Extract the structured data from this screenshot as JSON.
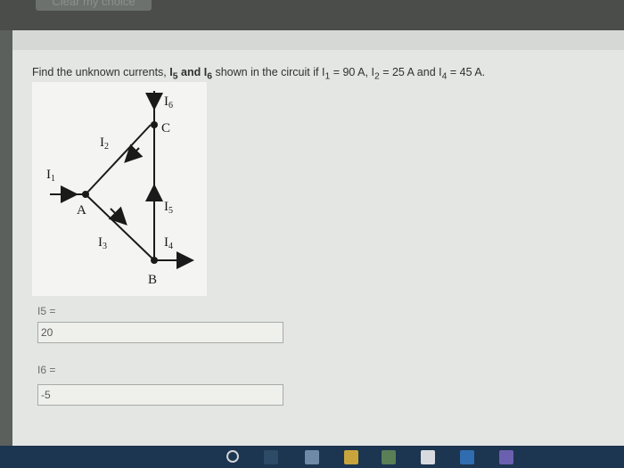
{
  "top_bar": {
    "clear_choice_label": "Clear my choice"
  },
  "question": {
    "prefix": "Find the unknown currents, ",
    "i5": "I",
    "i5_sub": "5",
    "and": " and ",
    "i6": "I",
    "i6_sub": "6",
    "suffix": " shown in the circuit if I",
    "i1_sub": "1",
    "i1_val": " = 90 A, I",
    "i2_sub": "2",
    "i2_val": " = 25 A and I",
    "i4_sub": "4",
    "i4_val": " = 45 A."
  },
  "circuit": {
    "labels": {
      "i1": "I",
      "i1_sub": "1",
      "i2": "I",
      "i2_sub": "2",
      "i3": "I",
      "i3_sub": "3",
      "i4": "I",
      "i4_sub": "4",
      "i5": "I",
      "i5_sub": "5",
      "i6": "I",
      "i6_sub": "6",
      "node_a": "A",
      "node_b": "B",
      "node_c": "C"
    }
  },
  "answers": [
    {
      "label": "I5 =",
      "value": "20"
    },
    {
      "label": "I6 =",
      "value": "-5"
    }
  ],
  "colors": {
    "wire": "#1a1a1a",
    "page_bg": "#e4e6e3",
    "taskbar": "#1c3550"
  }
}
